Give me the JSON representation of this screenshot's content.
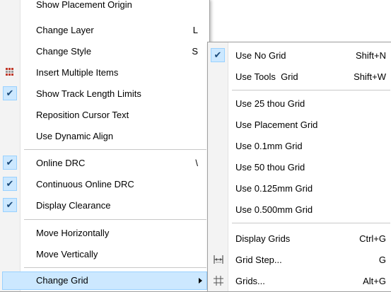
{
  "main_menu": {
    "partial_top_label": "Show Placement Origin",
    "items": [
      {
        "label": "Change Layer",
        "shortcut": "L"
      },
      {
        "label": "Change Style",
        "shortcut": "S"
      },
      {
        "label": "Insert Multiple Items",
        "shortcut": "",
        "icon": "multiple-items-icon"
      },
      {
        "label": "Show Track Length Limits",
        "shortcut": "",
        "checked": true
      },
      {
        "label": "Reposition Cursor Text",
        "shortcut": ""
      },
      {
        "label": "Use Dynamic Align",
        "shortcut": ""
      },
      {
        "label": "Online DRC",
        "shortcut": "\\",
        "checked": true
      },
      {
        "label": "Continuous Online DRC",
        "shortcut": "",
        "checked": true
      },
      {
        "label": "Display Clearance",
        "shortcut": "",
        "checked": true
      },
      {
        "label": "Move Horizontally",
        "shortcut": ""
      },
      {
        "label": "Move Vertically",
        "shortcut": ""
      },
      {
        "label": "Change Grid",
        "shortcut": "",
        "submenu": true,
        "highlighted": true
      }
    ]
  },
  "grid_submenu": {
    "items": [
      {
        "label": "Use No Grid",
        "shortcut": "Shift+N",
        "checked": true
      },
      {
        "label": "Use Tools  Grid",
        "shortcut": "Shift+W"
      },
      {
        "label": "Use 25 thou Grid",
        "shortcut": ""
      },
      {
        "label": "Use Placement Grid",
        "shortcut": ""
      },
      {
        "label": "Use 0.1mm Grid",
        "shortcut": ""
      },
      {
        "label": "Use 50 thou Grid",
        "shortcut": ""
      },
      {
        "label": "Use 0.125mm Grid",
        "shortcut": ""
      },
      {
        "label": "Use 0.500mm Grid",
        "shortcut": ""
      },
      {
        "label": "Display Grids",
        "shortcut": "Ctrl+G"
      },
      {
        "label": "Grid Step...",
        "shortcut": "G",
        "icon": "grid-step-icon"
      },
      {
        "label": "Grids...",
        "shortcut": "Alt+G",
        "icon": "grids-icon"
      }
    ]
  },
  "check_glyph": "✔"
}
